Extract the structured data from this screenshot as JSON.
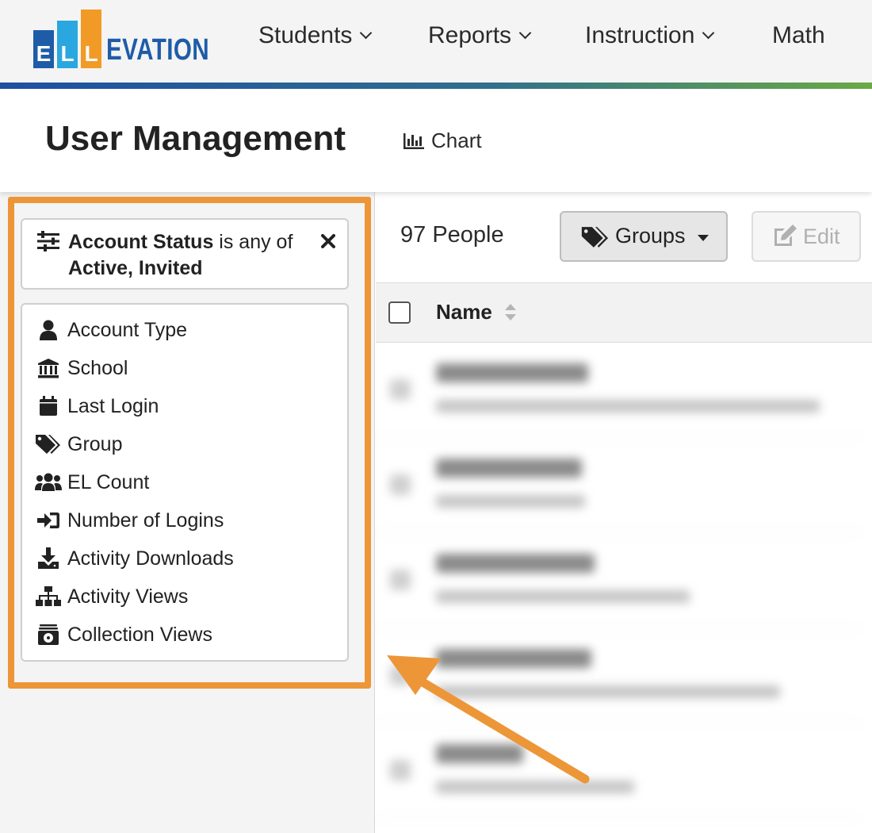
{
  "brand": {
    "letters": [
      "E",
      "L",
      "L"
    ],
    "wordmark": "EVATION"
  },
  "nav": {
    "items": [
      {
        "label": "Students",
        "dropdown": true
      },
      {
        "label": "Reports",
        "dropdown": true
      },
      {
        "label": "Instruction",
        "dropdown": true
      },
      {
        "label": "Math",
        "dropdown": false
      }
    ]
  },
  "header": {
    "title": "User Management",
    "chart_link": "Chart"
  },
  "filters": {
    "active_filter": {
      "field": "Account Status",
      "operator": " is any of",
      "values": "Active, Invited"
    },
    "attributes": [
      {
        "label": "Account Type",
        "icon": "user-icon"
      },
      {
        "label": "School",
        "icon": "school-icon"
      },
      {
        "label": "Last Login",
        "icon": "calendar-icon"
      },
      {
        "label": "Group",
        "icon": "tags-icon"
      },
      {
        "label": "EL Count",
        "icon": "users-icon"
      },
      {
        "label": "Number of Logins",
        "icon": "sign-in-icon"
      },
      {
        "label": "Activity Downloads",
        "icon": "download-icon"
      },
      {
        "label": "Activity Views",
        "icon": "sitemap-icon"
      },
      {
        "label": "Collection Views",
        "icon": "archive-icon"
      }
    ]
  },
  "toolbar": {
    "people_count": "97 People",
    "groups_label": "Groups",
    "edit_label": "Edit"
  },
  "table": {
    "column_name": "Name",
    "rows_blurred": 5
  },
  "colors": {
    "highlight": "#ec9638",
    "brand_blue": "#1e5ca8",
    "brand_cyan": "#2aa7e0",
    "brand_orange": "#f29a26"
  }
}
